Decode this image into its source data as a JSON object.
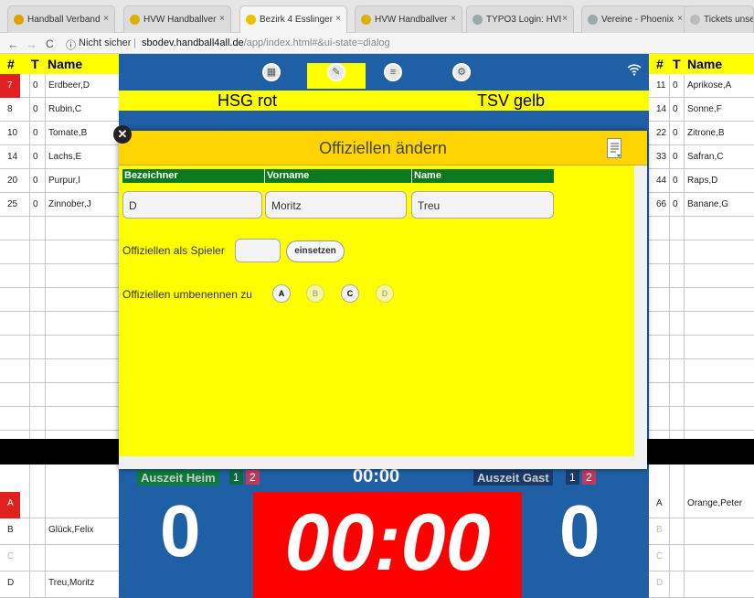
{
  "browser": {
    "tabs": [
      {
        "label": "Handball Verband",
        "close": "×",
        "color": "#e0a000",
        "active": false
      },
      {
        "label": "HVW Handballver",
        "close": "×",
        "color": "#e0b000",
        "active": false
      },
      {
        "label": "Bezirk 4 Esslinger",
        "close": "×",
        "color": "#f0c000",
        "active": true
      },
      {
        "label": "HVW Handballver",
        "close": "×",
        "color": "#e0b000",
        "active": false
      },
      {
        "label": "TYPO3 Login: HVI",
        "close": "×",
        "color": "#9aa",
        "active": false
      },
      {
        "label": "Vereine - Phoenix",
        "close": "×",
        "color": "#9aa",
        "active": false
      },
      {
        "label": "Tickets unserer",
        "close": "",
        "color": "#bbb",
        "active": false
      }
    ],
    "security": "Nicht sicher",
    "url_host": "sbodev.handball4all.de",
    "url_path": "/app/index.html#&ui-state=dialog"
  },
  "left_table": {
    "headers": {
      "num": "#",
      "t": "T",
      "name": "Name"
    },
    "rows": [
      {
        "num": "7",
        "t": "0",
        "name": "Erdbeer,D",
        "highlight": true
      },
      {
        "num": "8",
        "t": "0",
        "name": "Rubin,C"
      },
      {
        "num": "10",
        "t": "0",
        "name": "Tomate,B"
      },
      {
        "num": "14",
        "t": "0",
        "name": "Lachs,E"
      },
      {
        "num": "20",
        "t": "0",
        "name": "Purpur,I"
      },
      {
        "num": "25",
        "t": "0",
        "name": "Zinnober,J"
      }
    ],
    "officials": [
      {
        "label": "A",
        "name": "",
        "highlight": true
      },
      {
        "label": "B",
        "name": "Glück,Felix"
      },
      {
        "label": "C",
        "name": ""
      },
      {
        "label": "D",
        "name": "Treu,Moritz"
      }
    ]
  },
  "right_table": {
    "headers": {
      "num": "#",
      "t": "T",
      "name": "Name"
    },
    "rows": [
      {
        "num": "11",
        "t": "0",
        "name": "Aprikose,A"
      },
      {
        "num": "14",
        "t": "0",
        "name": "Sonne,F"
      },
      {
        "num": "22",
        "t": "0",
        "name": "Zitrone,B"
      },
      {
        "num": "33",
        "t": "0",
        "name": "Safran,C"
      },
      {
        "num": "44",
        "t": "0",
        "name": "Raps,D"
      },
      {
        "num": "66",
        "t": "0",
        "name": "Banane,G"
      }
    ],
    "officials": [
      {
        "label": "A",
        "name": "Orange,Peter"
      },
      {
        "label": "B",
        "name": ""
      },
      {
        "label": "C",
        "name": ""
      },
      {
        "label": "D",
        "name": ""
      }
    ]
  },
  "center": {
    "team_home": "HSG rot",
    "team_guest": "TSV gelb",
    "timeout_home": "Auszeit Heim",
    "timeout_guest": "Auszeit Gast",
    "timeout_nums": [
      "1",
      "2"
    ],
    "clock_small": "00:00",
    "clock_big": "00:00",
    "score_home": "0",
    "score_guest": "0"
  },
  "dialog": {
    "title": "Offiziellen ändern",
    "col_bezeichner": "Bezeichner",
    "col_vorname": "Vorname",
    "col_name": "Name",
    "value_bezeichner": "D",
    "value_vorname": "Moritz",
    "value_name": "Treu",
    "as_player_label": "Offiziellen als Spieler",
    "as_player_value": "",
    "einsetzen_label": "einsetzen",
    "rename_label": "Offiziellen umbenennen zu",
    "rename_options": [
      "A",
      "B",
      "C",
      "D"
    ]
  }
}
